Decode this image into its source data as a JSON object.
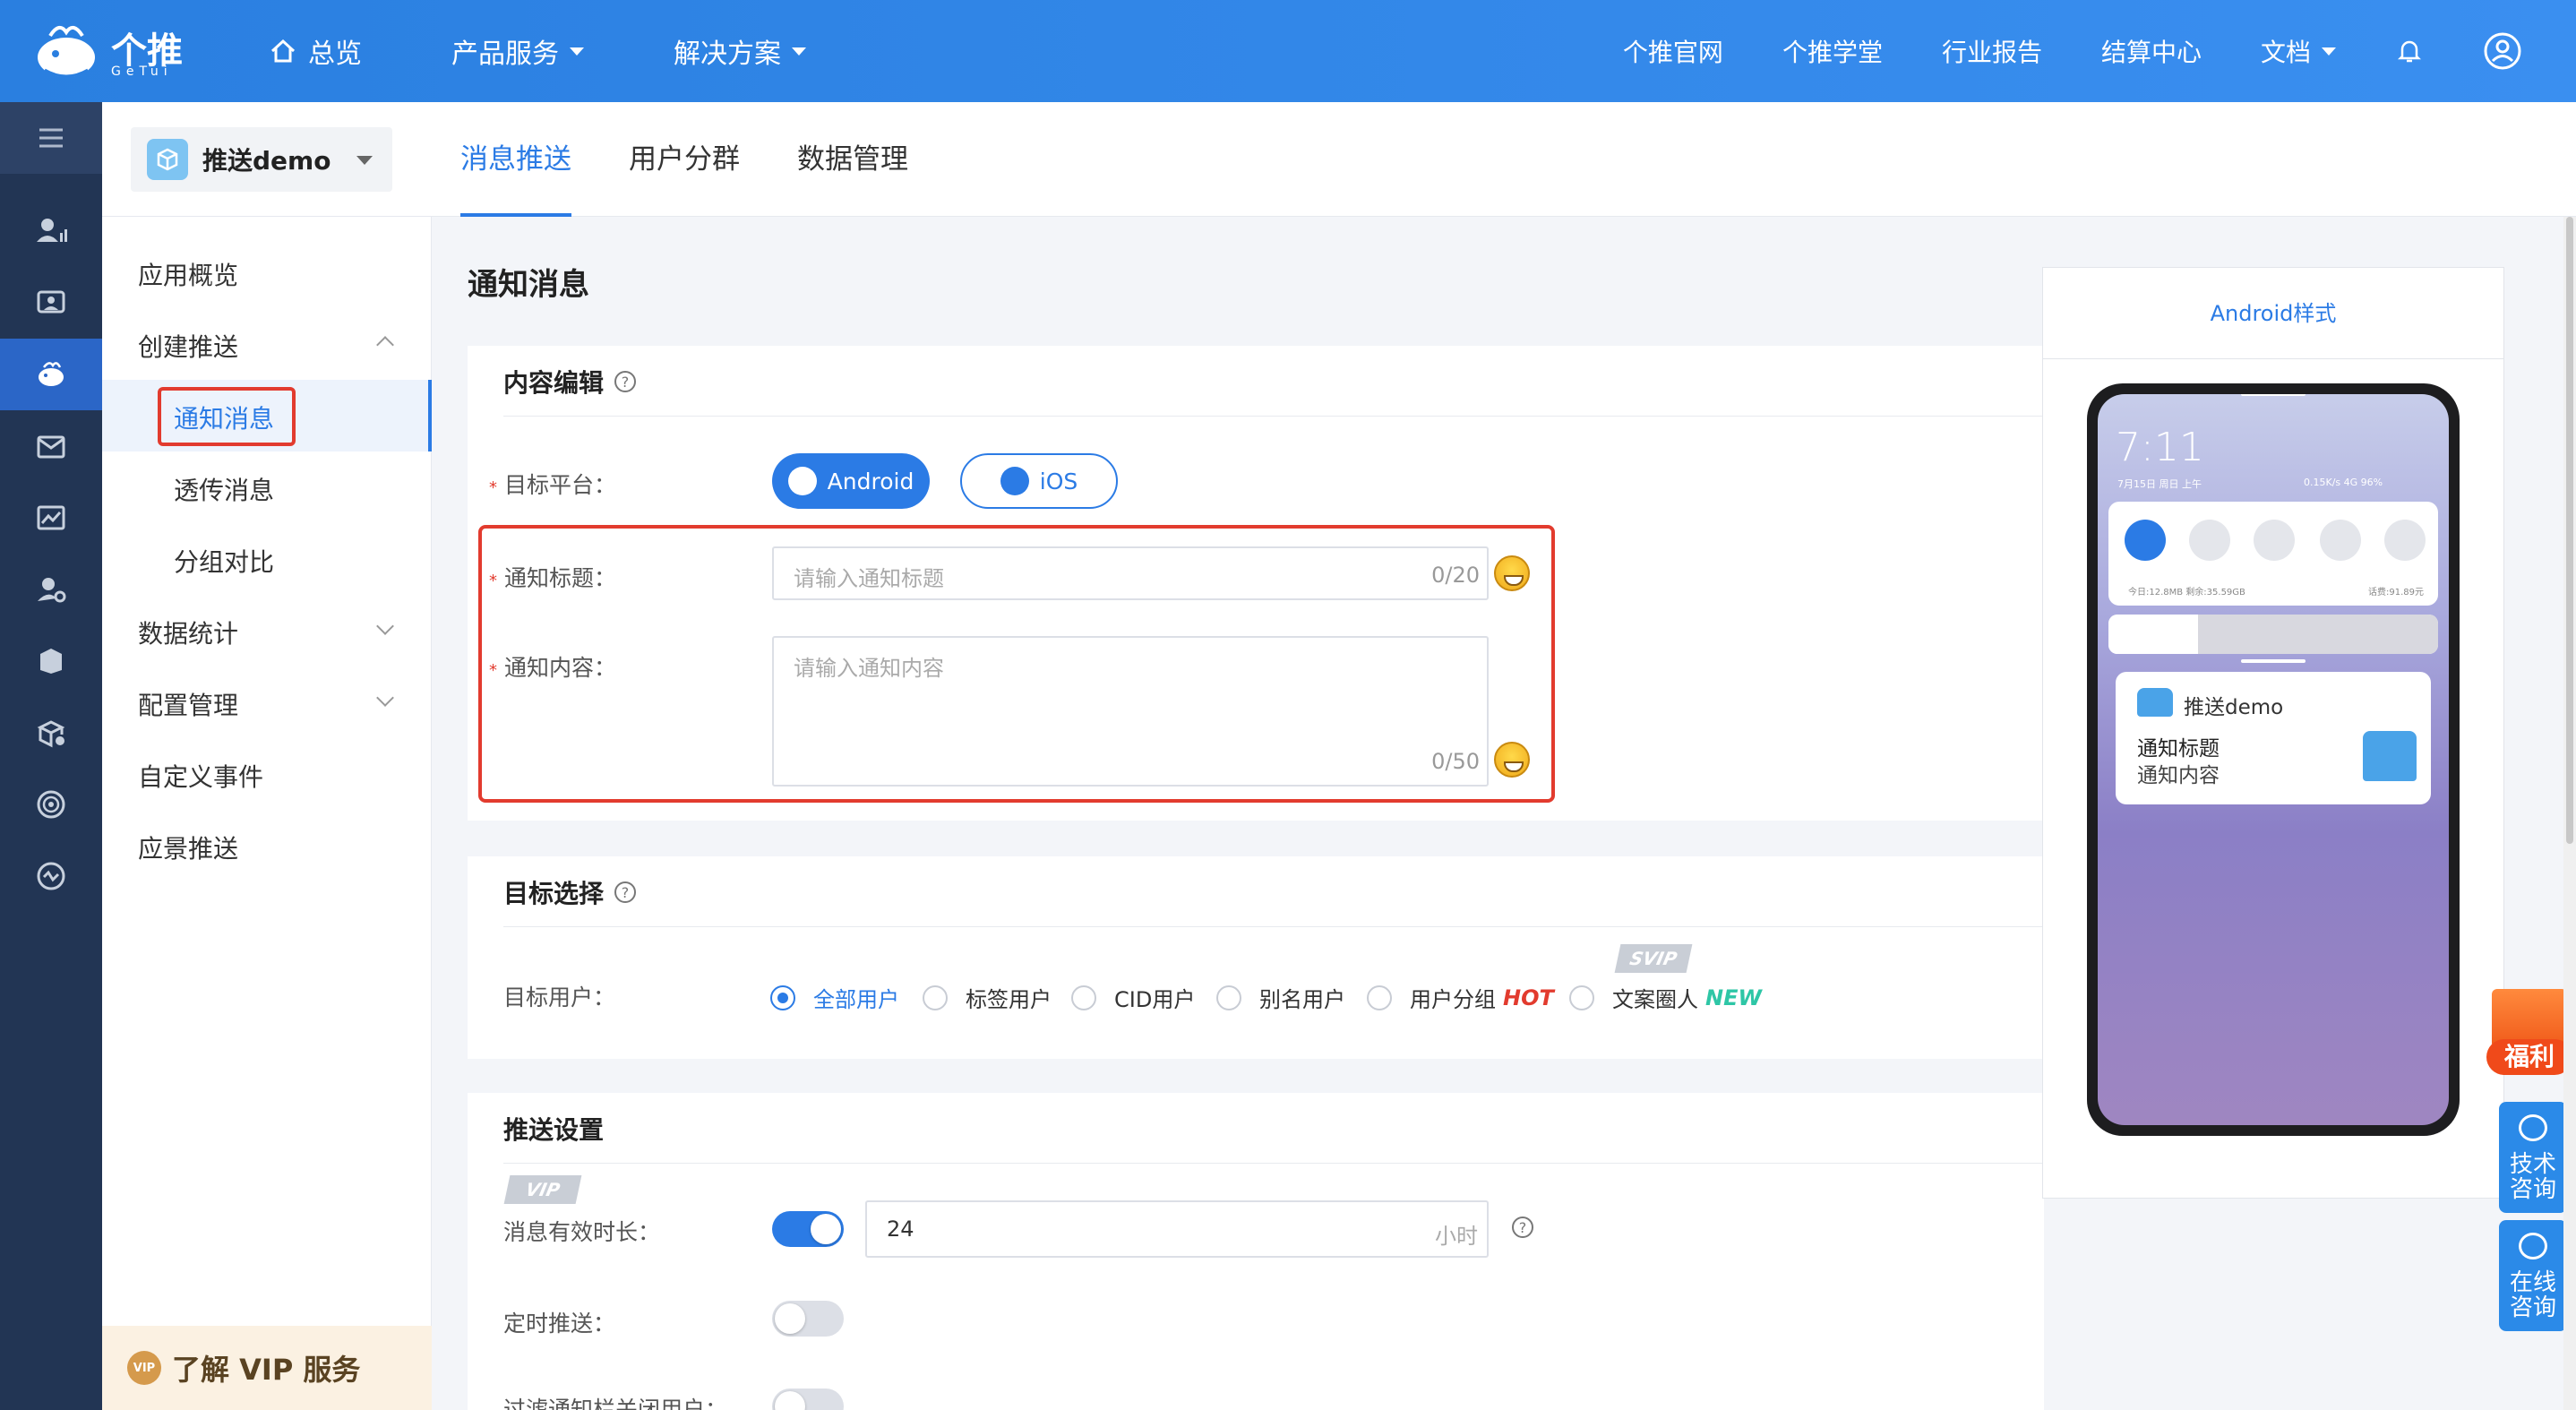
{
  "brand": {
    "name": "个推",
    "sub": "GeTui"
  },
  "topnav": {
    "left": [
      {
        "label": "总览"
      },
      {
        "label": "产品服务"
      },
      {
        "label": "解决方案"
      }
    ],
    "right": [
      {
        "label": "个推官网"
      },
      {
        "label": "个推学堂"
      },
      {
        "label": "行业报告"
      },
      {
        "label": "结算中心"
      },
      {
        "label": "文档"
      }
    ]
  },
  "app_selector": {
    "name": "推送demo"
  },
  "tabs": [
    {
      "label": "消息推送",
      "active": true
    },
    {
      "label": "用户分群",
      "active": false
    },
    {
      "label": "数据管理",
      "active": false
    }
  ],
  "menu": {
    "items": [
      {
        "label": "应用概览"
      },
      {
        "label": "创建推送"
      },
      {
        "label": "通知消息"
      },
      {
        "label": "透传消息"
      },
      {
        "label": "分组对比"
      },
      {
        "label": "数据统计"
      },
      {
        "label": "配置管理"
      },
      {
        "label": "自定义事件"
      },
      {
        "label": "应景推送"
      }
    ],
    "vip": {
      "badge": "VIP",
      "label": "了解 VIP 服务"
    }
  },
  "page": {
    "title": "通知消息"
  },
  "content_edit": {
    "title": "内容编辑",
    "platform_label": "目标平台：",
    "platforms": [
      "Android",
      "iOS"
    ],
    "selected_platform": "Android",
    "title_label": "通知标题：",
    "title_placeholder": "请输入通知标题",
    "title_count": "0/20",
    "content_label": "通知内容：",
    "content_placeholder": "请输入通知内容",
    "content_count": "0/50"
  },
  "target": {
    "title": "目标选择",
    "users_label": "目标用户：",
    "options": [
      {
        "label": "全部用户",
        "selected": true
      },
      {
        "label": "标签用户",
        "selected": false
      },
      {
        "label": "CID用户",
        "selected": false
      },
      {
        "label": "别名用户",
        "selected": false
      },
      {
        "label": "用户分组",
        "tag": "HOT",
        "selected": false
      },
      {
        "label": "文案圈人",
        "tag": "NEW",
        "selected": false
      }
    ],
    "svip_tag": "SVIP"
  },
  "push_settings": {
    "title": "推送设置",
    "vip_tag": "VIP",
    "ttl_label": "消息有效时长：",
    "ttl_enabled": true,
    "ttl_value": "24",
    "ttl_unit": "小时",
    "schedule_label": "定时推送：",
    "schedule_enabled": false,
    "filter_label": "过滤通知栏关闭用户：",
    "filter_enabled": false
  },
  "preview": {
    "title": "Android样式",
    "time": "7:11",
    "date": "7月15日 周日 上午",
    "status": "0.15K/s 4G 96%",
    "storage": "今日:12.8MB 剩余:35.59GB",
    "balance": "话费:91.89元",
    "notif_app": "推送demo",
    "notif_title": "通知标题",
    "notif_content": "通知内容"
  },
  "side_widgets": {
    "gift": "福利",
    "tech": "技术咨询",
    "online": "在线咨询"
  },
  "colors": {
    "primary": "#2b7be5",
    "topbar": "#3a8ff0",
    "darkbar": "#223554",
    "highlight": "#e23b2e"
  }
}
